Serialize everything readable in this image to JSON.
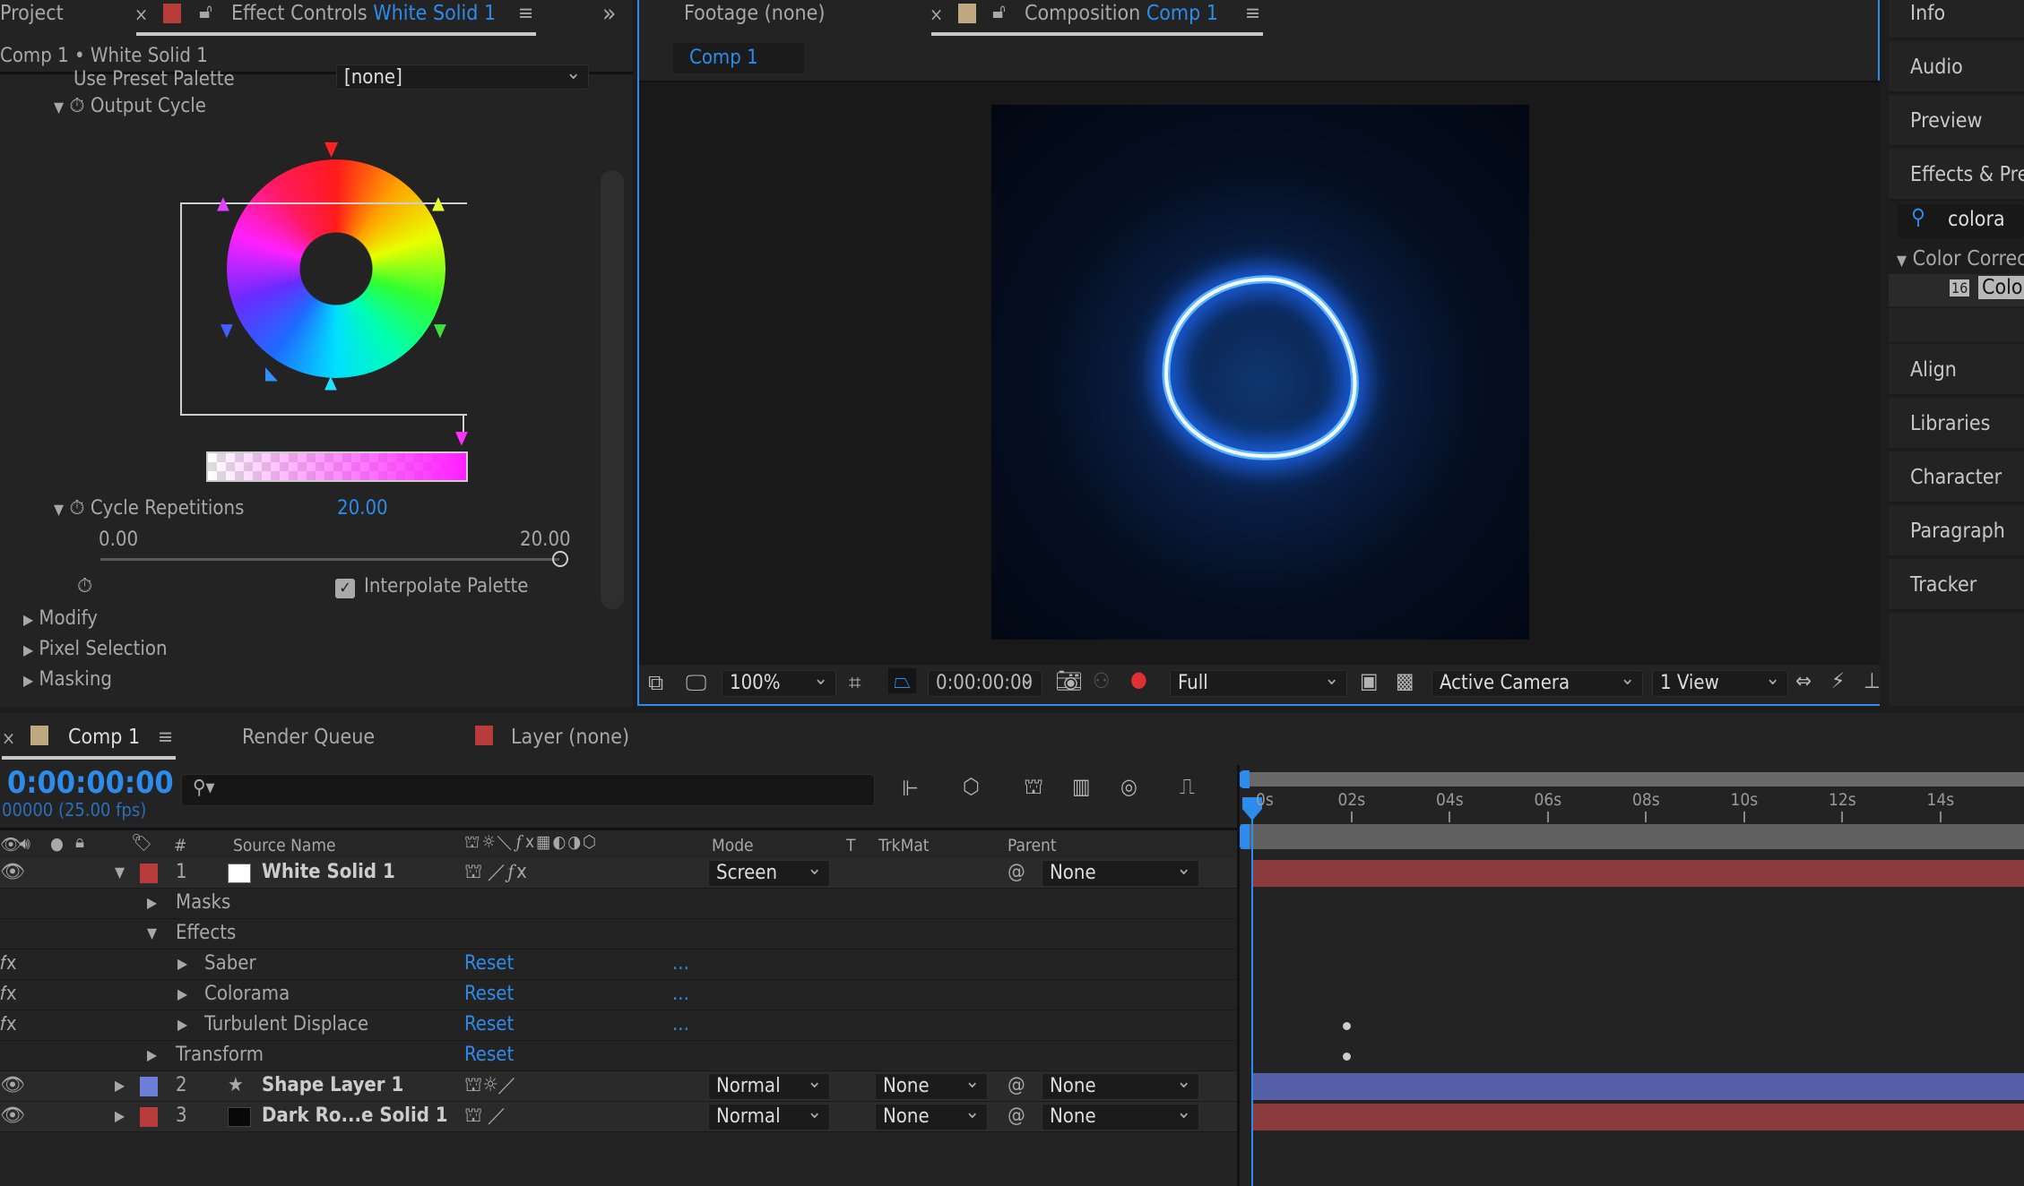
{
  "effect_panel": {
    "project_tab": "Project",
    "tab_prefix": "Effect Controls",
    "tab_layer": "White Solid 1",
    "breadcrumb": "Comp 1 • White Solid 1",
    "preset_label": "Use Preset Palette",
    "preset_value": "[none]",
    "output_cycle": "Output Cycle",
    "cycle_rep_label": "Cycle Repetitions",
    "cycle_rep_value": "20.00",
    "slider_min": "0.00",
    "slider_max": "20.00",
    "slider_fraction": 1.0,
    "interpolate_label": "Interpolate Palette",
    "interpolate_checked": true,
    "groups": [
      "Modify",
      "Pixel Selection",
      "Masking"
    ]
  },
  "viewer": {
    "footage_tab": "Footage (none)",
    "comp_tab_prefix": "Composition",
    "comp_tab_name": "Comp 1",
    "comp_chip": "Comp 1",
    "zoom": "100%",
    "timecode": "0:00:00:00",
    "resolution": "Full",
    "camera": "Active Camera",
    "views": "1 View"
  },
  "right_panel": {
    "items_top": [
      "Info",
      "Audio",
      "Preview",
      "Effects & Presets"
    ],
    "search_value": "colora",
    "category": "Color Correction",
    "result": "Colorama",
    "items_bottom": [
      "Align",
      "Libraries",
      "Character",
      "Paragraph",
      "Tracker"
    ]
  },
  "timeline": {
    "tabs": {
      "comp": "Comp 1",
      "render": "Render Queue",
      "layer": "Layer (none)"
    },
    "timecode": "0:00:00:00",
    "frames": "00000 (25.00 fps)",
    "columns": {
      "num": "#",
      "source": "Source Name",
      "mode": "Mode",
      "t": "T",
      "trkmat": "TrkMat",
      "parent": "Parent"
    },
    "ruler": [
      "0s",
      "02s",
      "04s",
      "06s",
      "08s",
      "10s",
      "12s",
      "14s"
    ],
    "layers": [
      {
        "num": "1",
        "name": "White Solid 1",
        "label_color": "#b83c3c",
        "mode": "Screen",
        "trkmat": "",
        "parent": "None",
        "bar_color": "#8a3a3a"
      },
      {
        "num": "2",
        "name": "Shape Layer 1",
        "label_color": "#6b7fd8",
        "mode": "Normal",
        "trkmat": "None",
        "parent": "None",
        "bar_color": "#5560a8"
      },
      {
        "num": "3",
        "name": "Dark Ro...e Solid 1",
        "label_color": "#b83c3c",
        "mode": "Normal",
        "trkmat": "None",
        "parent": "None",
        "bar_color": "#8a3a3a"
      }
    ],
    "sub": {
      "masks": "Masks",
      "effects": "Effects",
      "saber": "Saber",
      "colorama": "Colorama",
      "turbulent": "Turbulent Displace",
      "transform": "Transform",
      "reset": "Reset",
      "more": "..."
    }
  },
  "colors": {
    "accent": "#2d8ceb",
    "glow": "#4aa8ff"
  }
}
